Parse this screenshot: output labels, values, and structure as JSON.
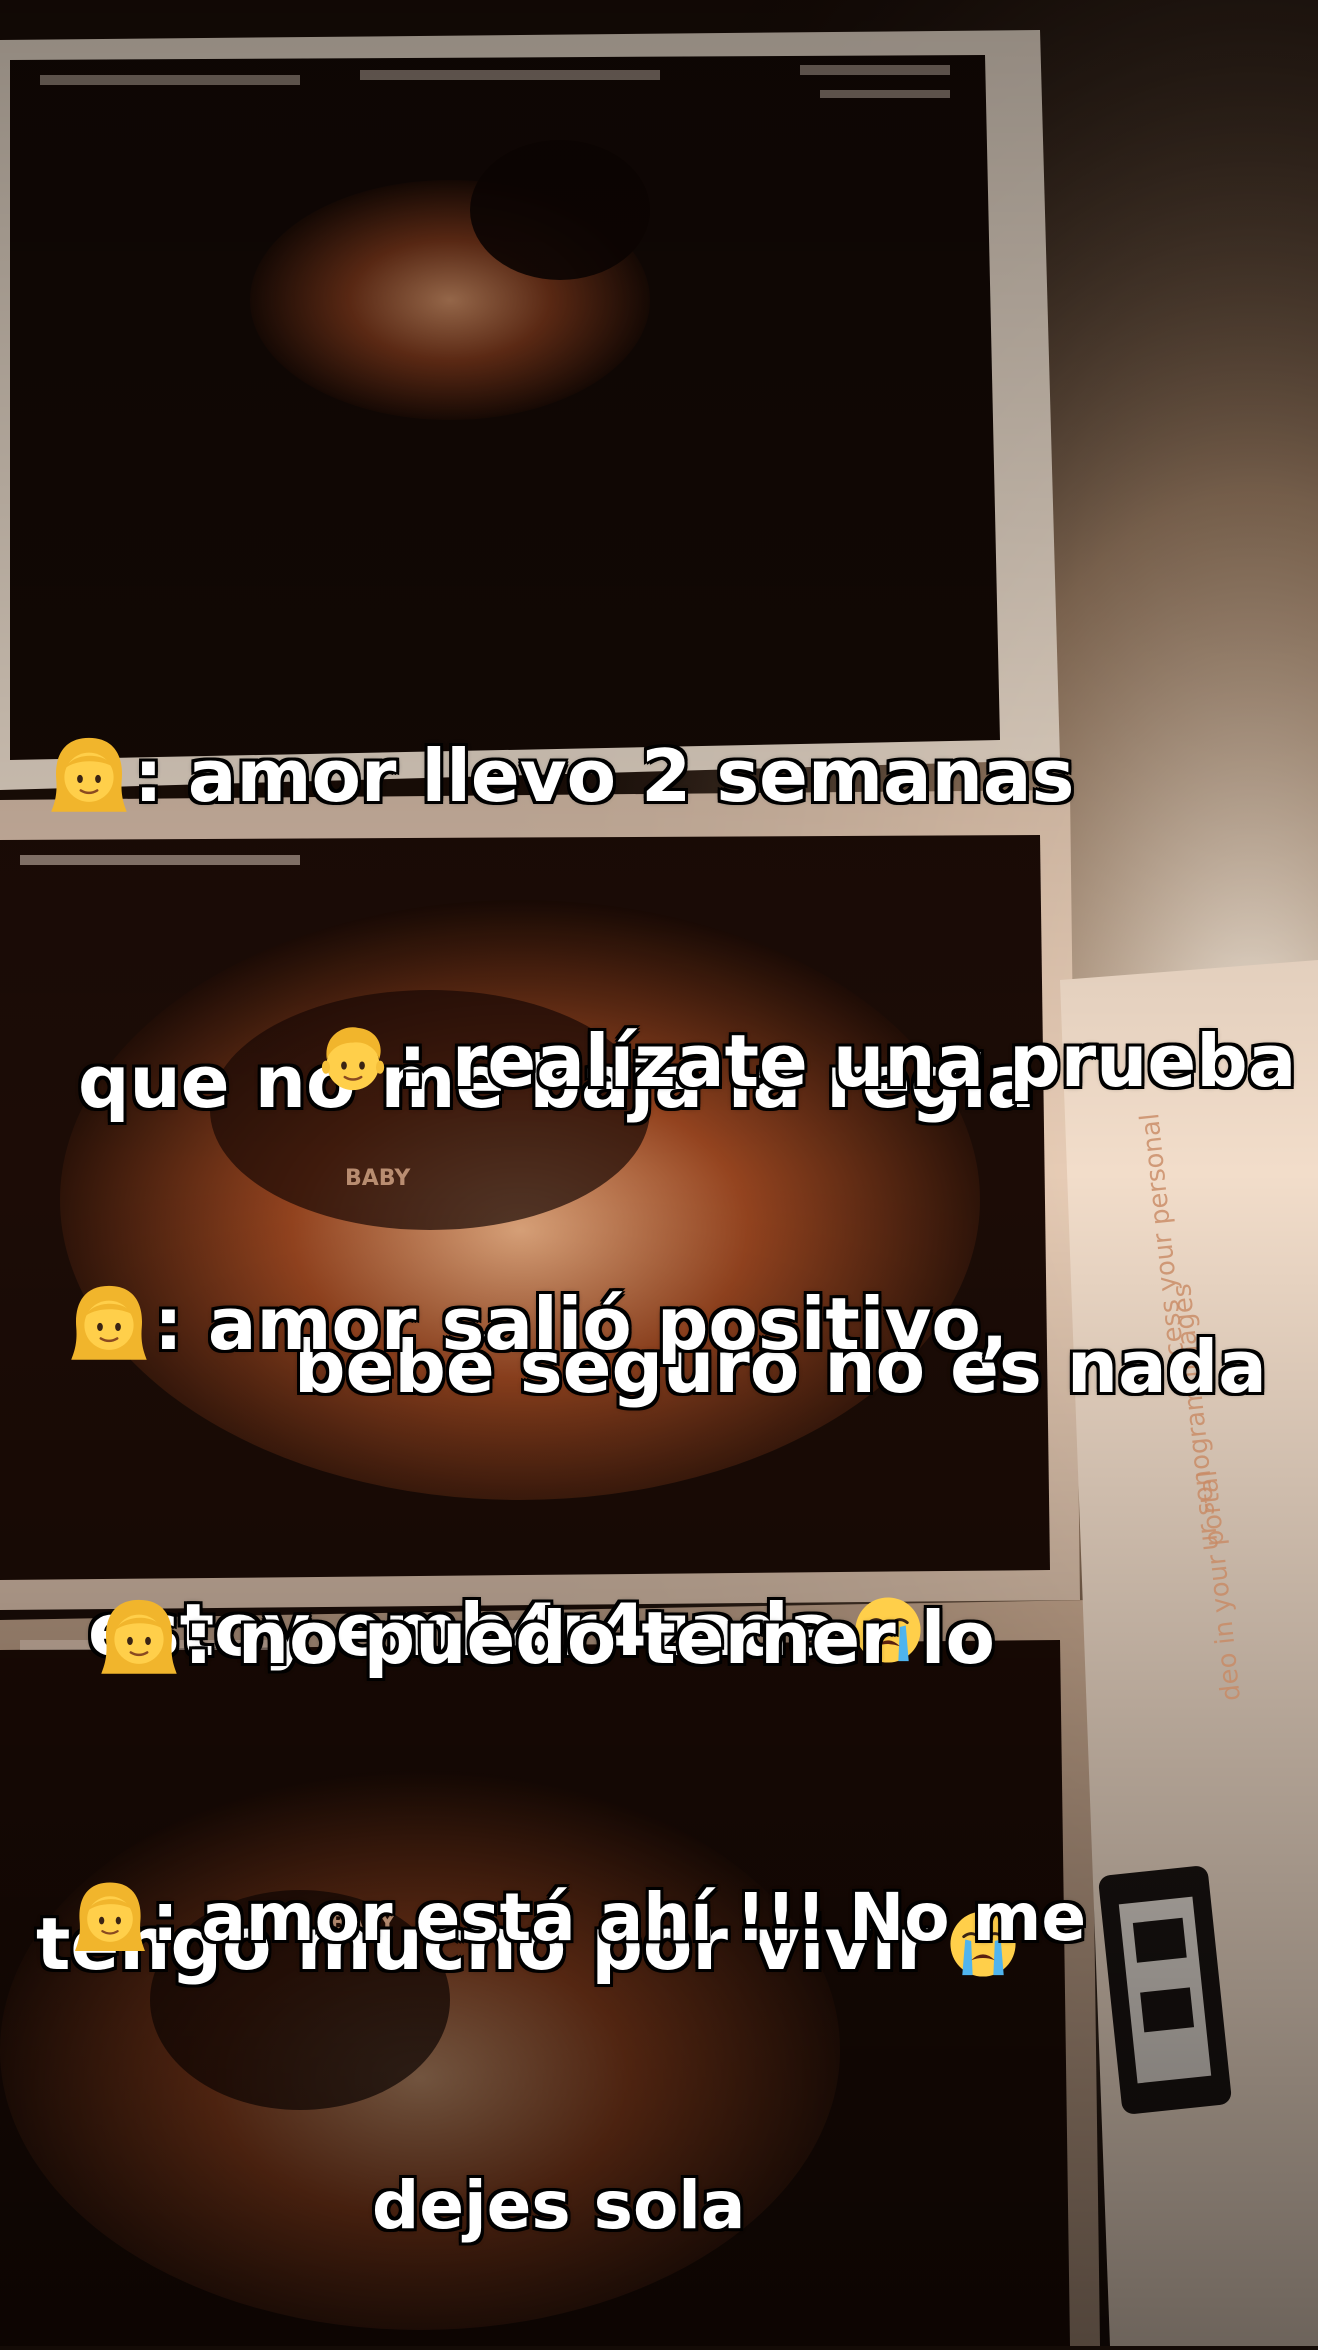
{
  "background": {
    "description_colors": {
      "dark": "#140b06",
      "sepia": "#c2683a",
      "paper": "#f3e2d2"
    },
    "icon": "ultrasound-photo"
  },
  "messages": [
    {
      "speaker_icon": "woman-emoji-icon",
      "line1": ": amor llevo 2 semanas",
      "line2": "que no me baja la regla",
      "end_icon": ""
    },
    {
      "speaker_icon": "man-emoji-icon",
      "line1": ": realízate una prueba",
      "line2": "bebé seguro no es nada",
      "end_icon": ""
    },
    {
      "speaker_icon": "woman-emoji-icon",
      "line1": ": amor salió positivo,",
      "line2": "estoy emb4r4zada",
      "end_icon": "crying-face-icon"
    },
    {
      "speaker_icon": "woman-emoji-icon",
      "line1": ": no puedo terner lo",
      "line2": "tengo mucho por vivir",
      "end_icon": "crying-face-icon"
    },
    {
      "speaker_icon": "woman-emoji-icon",
      "line1": ": amor está ahí !!! No me",
      "line2": "dejes sola",
      "end_icon": ""
    }
  ],
  "background_text": {
    "baby_label_1": "BABY",
    "baby_label_2": "BABY",
    "sidebar_text_1": "ccess your personal",
    "sidebar_text_2": "ur sonogram images",
    "sidebar_text_3": "deo in your portal"
  }
}
